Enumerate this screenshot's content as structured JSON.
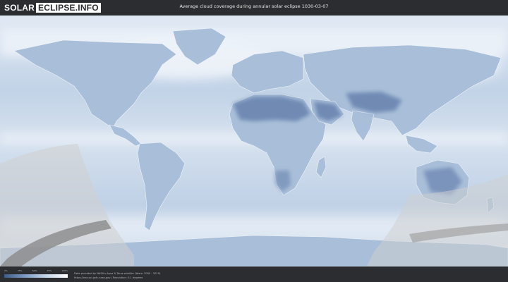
{
  "header": {
    "logo_part1": "SOLAR",
    "logo_part2": "ECLIPSE.INFO",
    "title": "Average cloud coverage during annular solar eclipse 1030-03-07"
  },
  "map": {
    "description_icon": "world-cloud-map",
    "colors": {
      "ocean": "#cddcec",
      "land": "#9cb4d2",
      "sahara": "#6d88b3",
      "clouds": "#eef3f9",
      "eclipse_overlay": "#cfcfcf",
      "path_band": "#8a8a8a"
    }
  },
  "legend": {
    "ticks": [
      "0%",
      "25%",
      "50%",
      "75%",
      "100%"
    ],
    "gradient": [
      "#3e5b87",
      "#7e9bc4",
      "#c6d6e9",
      "#ffffff"
    ]
  },
  "credits": {
    "line1": "Data provided by NASA's Aqua & Terra satellite (Years: 2000 - 2019)",
    "line2": "https://neo.sci.gsfc.nasa.gov  |  Resolution: 0.1 degrees"
  }
}
